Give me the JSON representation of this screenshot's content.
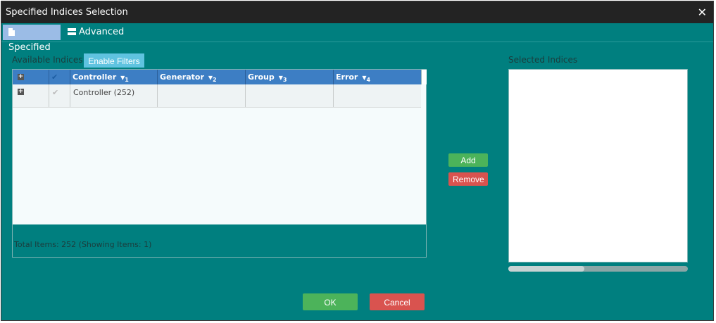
{
  "window": {
    "title": "Specified Indices Selection",
    "close_glyph": "✕"
  },
  "tabs": [
    {
      "label": "Specified",
      "icon": "document-icon"
    },
    {
      "label": "Advanced",
      "icon": "server-icon"
    }
  ],
  "available": {
    "label": "Available Indices",
    "filter_button": "Enable Filters",
    "columns": [
      {
        "label": "Controller",
        "sort_index": "1"
      },
      {
        "label": "Generator",
        "sort_index": "2"
      },
      {
        "label": "Group",
        "sort_index": "3"
      },
      {
        "label": "Error",
        "sort_index": "4"
      }
    ],
    "rows": [
      {
        "controller": "Controller (252)",
        "generator": "",
        "group": "",
        "error": ""
      }
    ],
    "total": "Total Items: 252 (Showing Items: 1)"
  },
  "actions": {
    "add": "Add",
    "remove": "Remove"
  },
  "selected": {
    "label": "Selected Indices"
  },
  "footer": {
    "ok": "OK",
    "cancel": "Cancel"
  },
  "colors": {
    "background": "#007f7f",
    "header": "#3d7ec4",
    "ok": "#4cb35a",
    "cancel": "#d9534f"
  }
}
